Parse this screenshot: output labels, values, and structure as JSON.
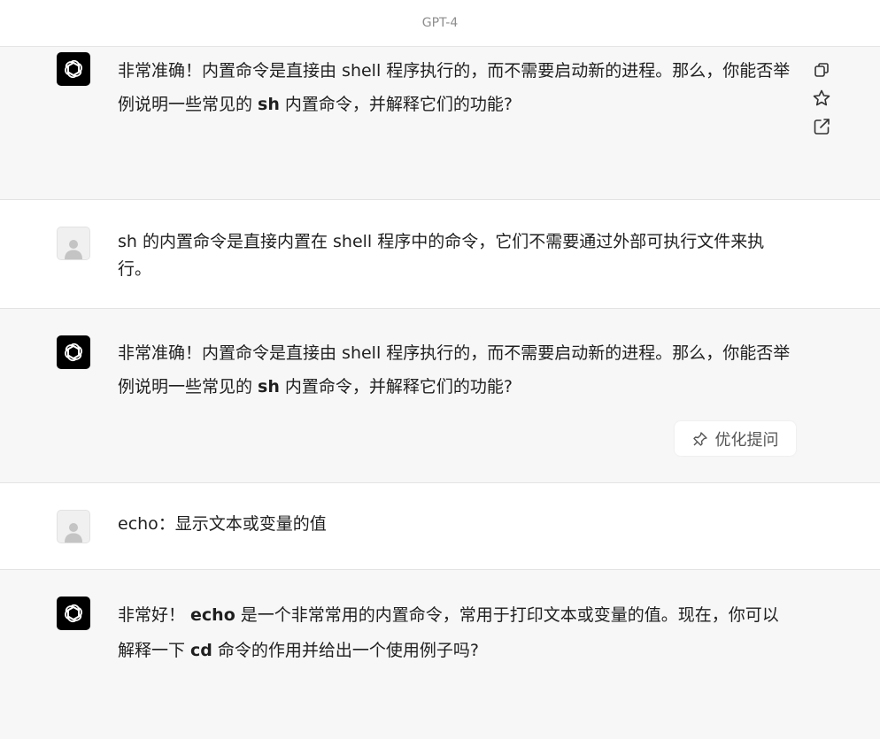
{
  "header": {
    "title": "GPT-4"
  },
  "messages": [
    {
      "role": "assistant",
      "pre": "非常准确！内置命令是直接由 shell 程序执行的，而不需要启动新的进程。那么，你能否举例说明一些常见的",
      "code": "sh",
      "post": "内置命令，并解释它们的功能?"
    },
    {
      "role": "user",
      "text": "sh 的内置命令是直接内置在 shell 程序中的命令，它们不需要通过外部可执行文件来执行。"
    },
    {
      "role": "assistant",
      "pre": "非常准确！内置命令是直接由 shell 程序执行的，而不需要启动新的进程。那么，你能否举例说明一些常见的",
      "code": "sh",
      "post": "内置命令，并解释它们的功能?",
      "action_label": "优化提问"
    },
    {
      "role": "user",
      "text": "echo：显示文本或变量的值"
    },
    {
      "role": "assistant",
      "pre": "非常好！",
      "code": "echo",
      "mid": "是一个非常常用的内置命令，常用于打印文本或变量的值。现在，你可以解释一下",
      "code2": "cd",
      "post": "命令的作用并给出一个使用例子吗?"
    }
  ],
  "icons": {
    "copy": "copy-icon",
    "star": "star-icon",
    "share": "share-icon",
    "optimize": "pin-icon",
    "assistant_avatar": "openai-logo-icon",
    "user_avatar": "user-avatar-icon"
  },
  "colors": {
    "assistant_bg": "#f7f7f7",
    "user_bg": "#ffffff",
    "avatar_bg": "#000000"
  }
}
